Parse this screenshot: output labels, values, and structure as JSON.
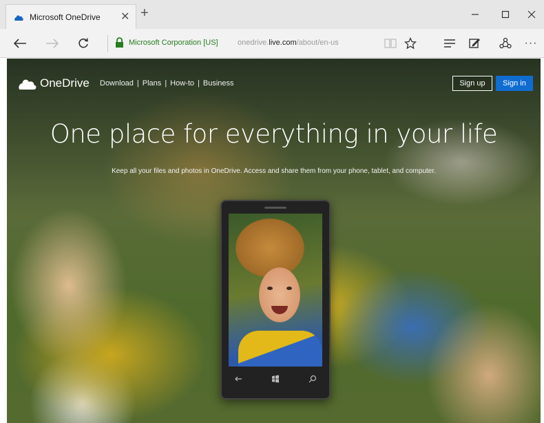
{
  "browser": {
    "tab": {
      "title": "Microsoft OneDrive",
      "close_glyph": "✕"
    },
    "new_tab_glyph": "+",
    "window": {
      "minimize_icon": "minimize-icon",
      "maximize_icon": "maximize-icon",
      "close_icon": "close-icon"
    },
    "address": {
      "site_identity": "Microsoft Corporation [US]",
      "url_prefix": "onedrive.",
      "url_domain": "live.com",
      "url_path": "/about/en-us"
    },
    "toolbar": {
      "more_glyph": "···"
    },
    "colors": {
      "secure_green": "#267e1f",
      "tab_strip": "#e6e6e6"
    }
  },
  "site": {
    "brand": "OneDrive",
    "nav": [
      "Download",
      "Plans",
      "How-to",
      "Business"
    ],
    "nav_separator": "|",
    "signup_label": "Sign up",
    "signin_label": "Sign in",
    "headline": "One place for everything in your life",
    "subline": "Keep all your files and photos in OneDrive. Access and share them from your phone, tablet, and computer.",
    "colors": {
      "signin_bg": "#0f6cd1"
    }
  }
}
